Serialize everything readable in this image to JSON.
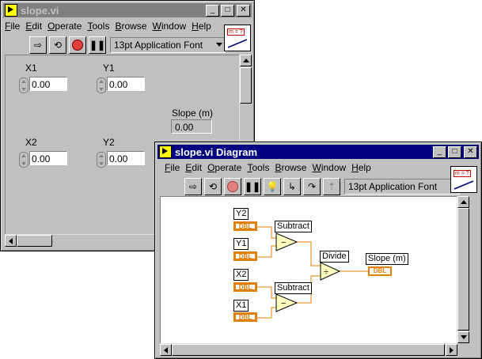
{
  "front_panel": {
    "title": "slope.vi",
    "menu": [
      "File",
      "Edit",
      "Operate",
      "Tools",
      "Browse",
      "Window",
      "Help"
    ],
    "font_selector": "13pt Application Font",
    "icon_text": "m = ?",
    "controls": [
      {
        "label": "X1",
        "value": "0.00"
      },
      {
        "label": "Y1",
        "value": "0.00"
      },
      {
        "label": "X2",
        "value": "0.00"
      },
      {
        "label": "Y2",
        "value": "0.00"
      }
    ],
    "indicator": {
      "label": "Slope (m)",
      "value": "0.00"
    }
  },
  "diagram": {
    "title": "slope.vi Diagram",
    "menu": [
      "File",
      "Edit",
      "Operate",
      "Tools",
      "Browse",
      "Window",
      "Help"
    ],
    "font_selector": "13pt Application Font",
    "icon_text": "m = ?",
    "terminals": {
      "y2": "Y2",
      "y1": "Y1",
      "x2": "X2",
      "x1": "X1",
      "slope": "Slope (m)"
    },
    "type_tag": "DBL",
    "functions": {
      "subtract_top": "Subtract",
      "subtract_bottom": "Subtract",
      "divide": "Divide"
    },
    "symbols": {
      "subtract": "−",
      "divide": "÷"
    }
  },
  "colors": {
    "wire": "#e08000",
    "titlebar_active": "#000080",
    "titlebar_inactive": "#808080"
  }
}
